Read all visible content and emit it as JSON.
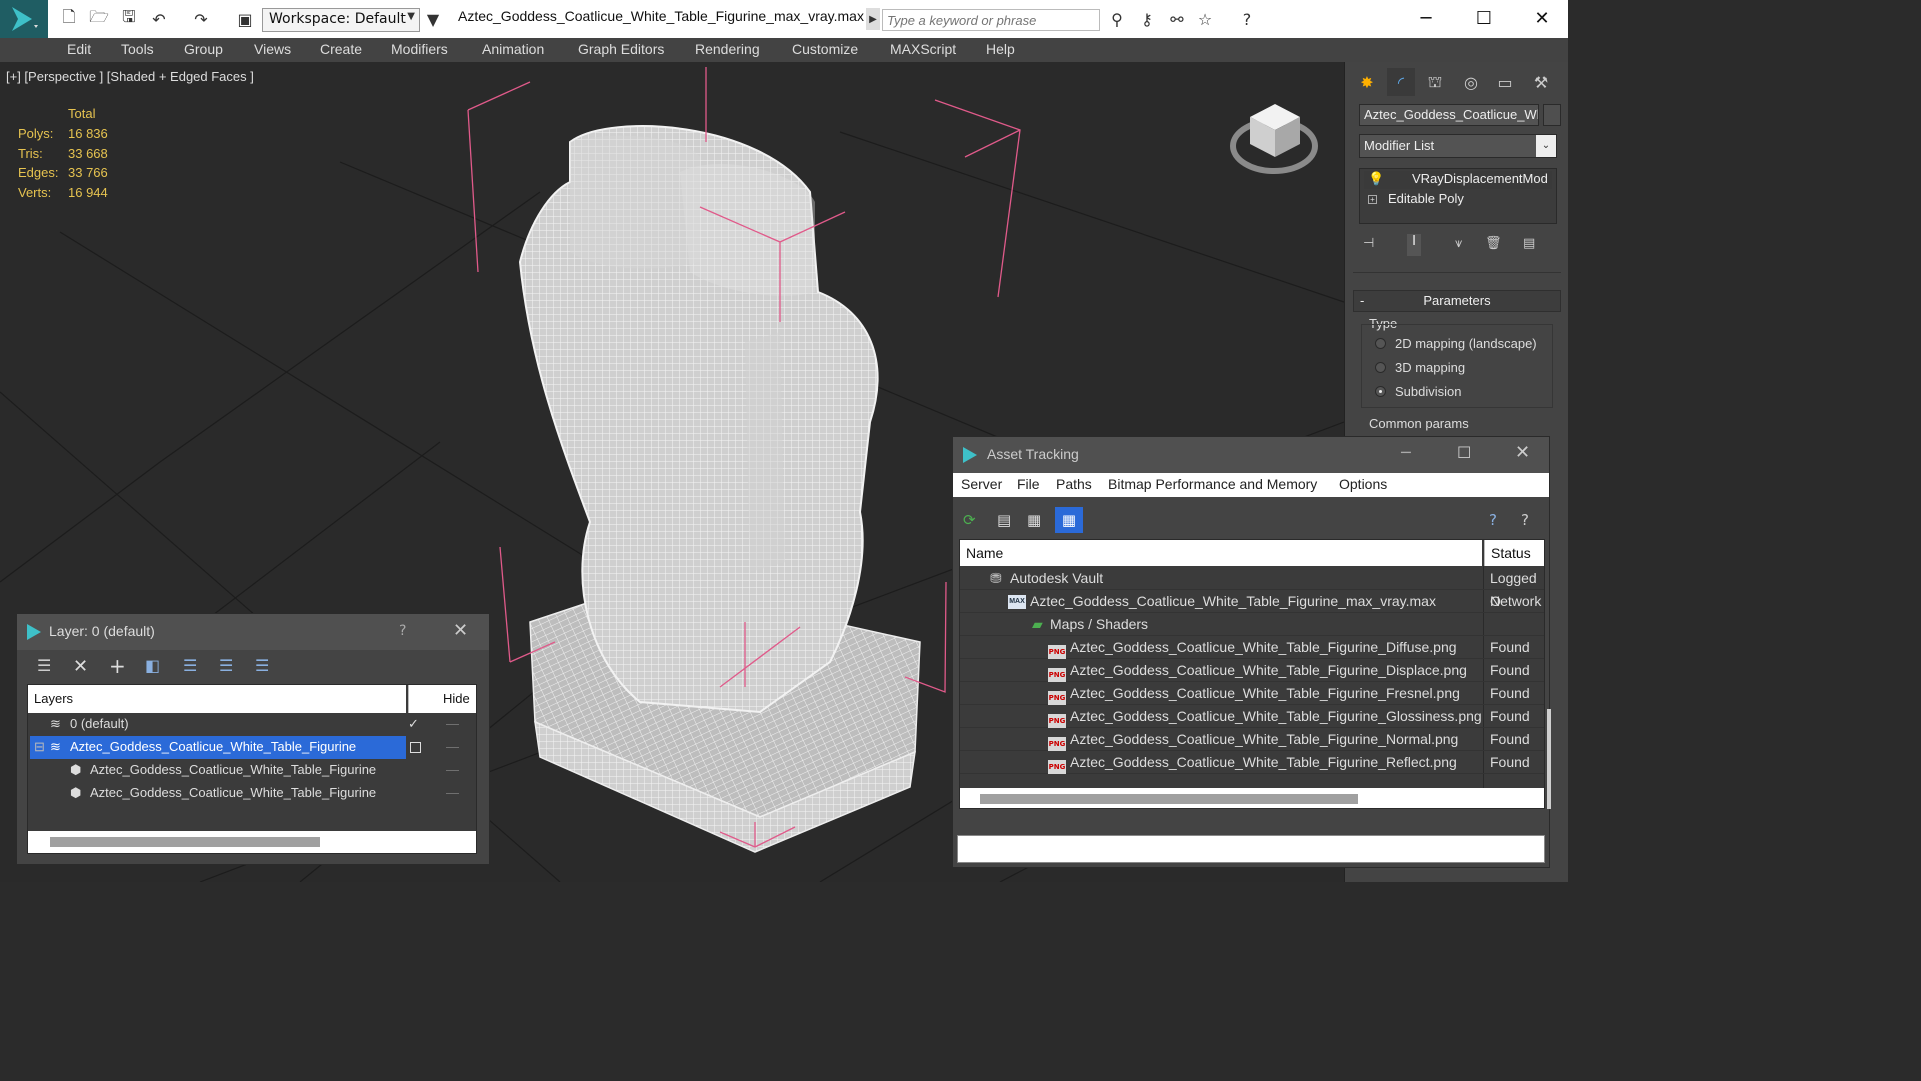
{
  "titlebar": {
    "workspace": "Workspace: Default",
    "file_title": "Aztec_Goddess_Coatlicue_White_Table_Figurine_max_vray.max",
    "search_placeholder": "Type a keyword or phrase"
  },
  "menu": [
    "Edit",
    "Tools",
    "Group",
    "Views",
    "Create",
    "Modifiers",
    "Animation",
    "Graph Editors",
    "Rendering",
    "Customize",
    "MAXScript",
    "Help"
  ],
  "viewport": {
    "label": "[+] [Perspective ] [Shaded + Edged Faces ]",
    "stats_header": "Total",
    "stats": [
      {
        "label": "Polys:",
        "value": "16 836"
      },
      {
        "label": "Tris:",
        "value": "33 668"
      },
      {
        "label": "Edges:",
        "value": "33 766"
      },
      {
        "label": "Verts:",
        "value": "16 944"
      }
    ]
  },
  "command_panel": {
    "object_name": "Aztec_Goddess_Coatlicue_White",
    "modifier_list": "Modifier List",
    "stack": [
      "VRayDisplacementMod",
      "Editable Poly"
    ],
    "rollout_title": "Parameters",
    "type_label": "Type",
    "options": [
      "2D mapping (landscape)",
      "3D mapping",
      "Subdivision"
    ],
    "selected_option": "Subdivision",
    "common_params": "Common params"
  },
  "layer_window": {
    "title": "Layer: 0 (default)",
    "help": "?",
    "col_layers": "Layers",
    "col_hide": "Hide",
    "rows": [
      {
        "name": "0 (default)",
        "indent": 0,
        "selected": false
      },
      {
        "name": "Aztec_Goddess_Coatlicue_White_Table_Figurine",
        "indent": 0,
        "selected": true
      },
      {
        "name": "Aztec_Goddess_Coatlicue_White_Table_Figurine",
        "indent": 1,
        "selected": false
      },
      {
        "name": "Aztec_Goddess_Coatlicue_White_Table_Figurine",
        "indent": 1,
        "selected": false
      }
    ]
  },
  "asset_window": {
    "title": "Asset Tracking",
    "menu": [
      "Server",
      "File",
      "Paths",
      "Bitmap Performance and Memory",
      "Options"
    ],
    "col_name": "Name",
    "col_status": "Status",
    "rows": [
      {
        "name": "Autodesk Vault",
        "status": "Logged O",
        "icon": "vault",
        "indent": 0
      },
      {
        "name": "Aztec_Goddess_Coatlicue_White_Table_Figurine_max_vray.max",
        "status": "Network",
        "icon": "max",
        "indent": 1
      },
      {
        "name": "Maps / Shaders",
        "status": "",
        "icon": "folder",
        "indent": 2
      },
      {
        "name": "Aztec_Goddess_Coatlicue_White_Table_Figurine_Diffuse.png",
        "status": "Found",
        "icon": "png",
        "indent": 3
      },
      {
        "name": "Aztec_Goddess_Coatlicue_White_Table_Figurine_Displace.png",
        "status": "Found",
        "icon": "png",
        "indent": 3
      },
      {
        "name": "Aztec_Goddess_Coatlicue_White_Table_Figurine_Fresnel.png",
        "status": "Found",
        "icon": "png",
        "indent": 3
      },
      {
        "name": "Aztec_Goddess_Coatlicue_White_Table_Figurine_Glossiness.png",
        "status": "Found",
        "icon": "png",
        "indent": 3
      },
      {
        "name": "Aztec_Goddess_Coatlicue_White_Table_Figurine_Normal.png",
        "status": "Found",
        "icon": "png",
        "indent": 3
      },
      {
        "name": "Aztec_Goddess_Coatlicue_White_Table_Figurine_Reflect.png",
        "status": "Found",
        "icon": "png",
        "indent": 3
      }
    ]
  },
  "colors": {
    "accent": "#2b6ad8",
    "stats": "#e6c350",
    "bbox": "#e05a8a"
  }
}
